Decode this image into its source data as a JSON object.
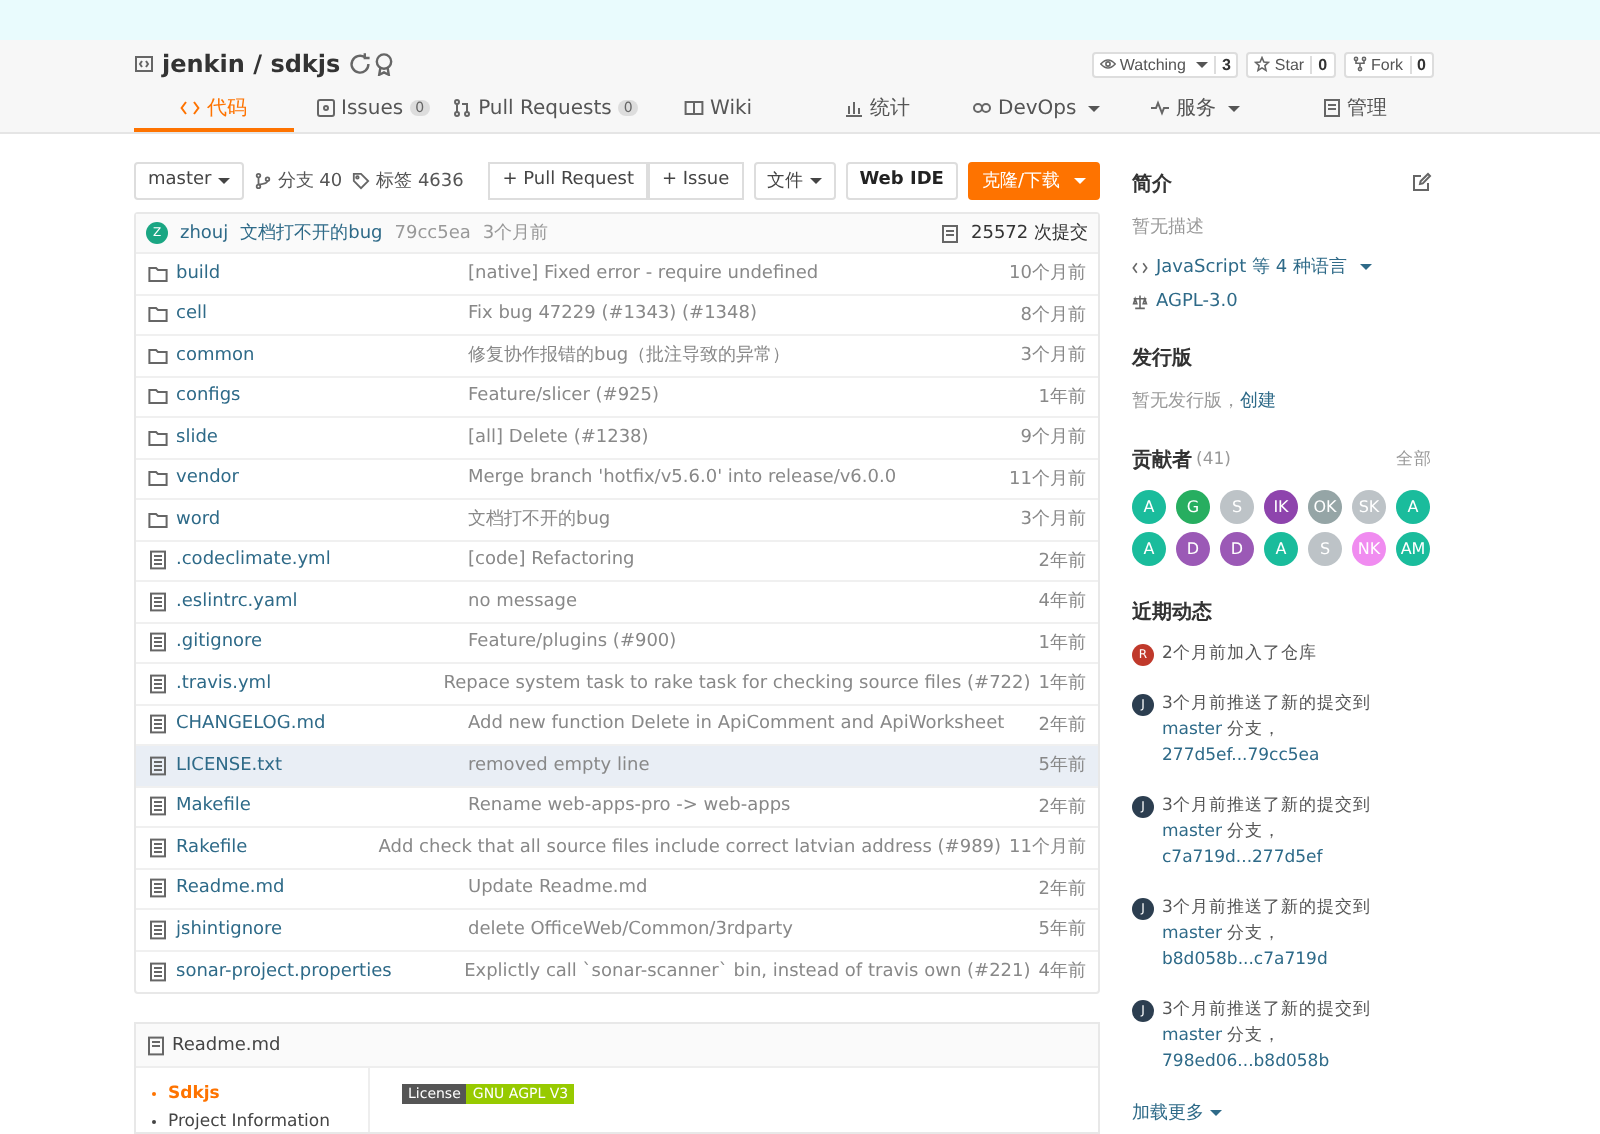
{
  "repo": {
    "owner": "jenkin",
    "sep": "/",
    "name": "sdkjs",
    "actions": [
      {
        "label": "Watching",
        "count": "3",
        "dropdown": true
      },
      {
        "label": "Star",
        "count": "0",
        "dropdown": false
      },
      {
        "label": "Fork",
        "count": "0",
        "dropdown": false
      }
    ]
  },
  "tabs": [
    {
      "label": "代码",
      "selected": true
    },
    {
      "label": "Issues",
      "count": "0",
      "selected": false
    },
    {
      "label": "Pull Requests",
      "count": "0",
      "selected": false
    },
    {
      "label": "Wiki",
      "selected": false
    },
    {
      "label": "统计",
      "selected": false
    },
    {
      "label": "DevOps",
      "dropdown": true,
      "selected": false
    },
    {
      "label": "服务",
      "dropdown": true,
      "selected": false
    },
    {
      "label": "管理",
      "selected": false
    }
  ],
  "toolbar": {
    "branch": "master",
    "branches": "分支 40",
    "tags": "标签 4636",
    "buttons": [
      {
        "label": "+ Pull Request",
        "kind": "plain"
      },
      {
        "label": "+ Issue",
        "kind": "plain"
      },
      {
        "label": "文件",
        "kind": "dropdown"
      },
      {
        "label": "Web IDE",
        "kind": "bold"
      },
      {
        "label": "克隆/下载",
        "kind": "primary"
      }
    ]
  },
  "latest_commit": {
    "avatar": "Z",
    "author": "zhouj",
    "message": "文档打不开的bug",
    "sha": "79cc5ea",
    "time": "3个月前",
    "commits": "25572 次提交"
  },
  "files": [
    {
      "kind": "folder",
      "name": "build",
      "message": "[native] Fixed error - require undefined",
      "time": "10个月前",
      "hovered": false
    },
    {
      "kind": "folder",
      "name": "cell",
      "message": "Fix bug 47229 (#1343) (#1348)",
      "time": "8个月前",
      "hovered": false
    },
    {
      "kind": "folder",
      "name": "common",
      "message": "修复协作报错的bug（批注导致的异常）",
      "time": "3个月前",
      "hovered": false
    },
    {
      "kind": "folder",
      "name": "configs",
      "message": "Feature/slicer (#925)",
      "time": "1年前",
      "hovered": false
    },
    {
      "kind": "folder",
      "name": "slide",
      "message": "[all] Delete (#1238)",
      "time": "9个月前",
      "hovered": false
    },
    {
      "kind": "folder",
      "name": "vendor",
      "message": "Merge branch 'hotfix/v5.6.0' into release/v6.0.0",
      "time": "11个月前",
      "hovered": false
    },
    {
      "kind": "folder",
      "name": "word",
      "message": "文档打不开的bug",
      "time": "3个月前",
      "hovered": false
    },
    {
      "kind": "file",
      "name": ".codeclimate.yml",
      "message": "[code] Refactoring",
      "time": "2年前",
      "hovered": false
    },
    {
      "kind": "file",
      "name": ".eslintrc.yaml",
      "message": "no message",
      "time": "4年前",
      "hovered": false
    },
    {
      "kind": "file",
      "name": ".gitignore",
      "message": "Feature/plugins (#900)",
      "time": "1年前",
      "hovered": false
    },
    {
      "kind": "file",
      "name": ".travis.yml",
      "message": "Repace system task to rake task for checking source files (#722)",
      "time": "1年前",
      "hovered": false
    },
    {
      "kind": "file",
      "name": "CHANGELOG.md",
      "message": "Add new function Delete in ApiComment and ApiWorksheet",
      "time": "2年前",
      "hovered": false
    },
    {
      "kind": "file",
      "name": "LICENSE.txt",
      "message": "removed empty line",
      "time": "5年前",
      "hovered": true
    },
    {
      "kind": "file",
      "name": "Makefile",
      "message": "Rename web-apps-pro -> web-apps",
      "time": "2年前",
      "hovered": false
    },
    {
      "kind": "file",
      "name": "Rakefile",
      "message": "Add check that all source files include correct latvian address (#989)",
      "time": "11个月前",
      "hovered": false
    },
    {
      "kind": "file",
      "name": "Readme.md",
      "message": "Update Readme.md",
      "time": "2年前",
      "hovered": false
    },
    {
      "kind": "file",
      "name": "jshintignore",
      "message": "delete OfficeWeb/Common/3rdparty",
      "time": "5年前",
      "hovered": false
    },
    {
      "kind": "file",
      "name": "sonar-project.properties",
      "message": "Explictly call `sonar-scanner` bin, instead of travis own (#221)",
      "time": "4年前",
      "hovered": false
    }
  ],
  "readme": {
    "title": "Readme.md",
    "toc": [
      {
        "label": "Sdkjs",
        "selected": true
      },
      {
        "label": "Project Information",
        "selected": false
      }
    ],
    "badge": {
      "label": "License",
      "value": "GNU AGPL V3"
    }
  },
  "sidebar": {
    "intro": {
      "title": "简介",
      "description": "暂无描述",
      "languages": "JavaScript 等 4 种语言",
      "license": "AGPL-3.0"
    },
    "releases": {
      "title": "发行版",
      "text": "暂无发行版，",
      "link": "创建"
    },
    "contributors": {
      "title": "贡献者",
      "count": "(41)",
      "all": "全部",
      "people": [
        {
          "initials": "A",
          "color": "#1abc9c"
        },
        {
          "initials": "G",
          "color": "#27ae60"
        },
        {
          "initials": "S",
          "color": "#bdc3c7"
        },
        {
          "initials": "IK",
          "color": "#8e44ad"
        },
        {
          "initials": "OK",
          "color": "#95a5a6"
        },
        {
          "initials": "SK",
          "color": "#bdc3c7"
        },
        {
          "initials": "A",
          "color": "#1abc9c"
        },
        {
          "initials": "A",
          "color": "#1abc9c"
        },
        {
          "initials": "D",
          "color": "#9b59b6"
        },
        {
          "initials": "D",
          "color": "#9b59b6"
        },
        {
          "initials": "A",
          "color": "#1abc9c"
        },
        {
          "initials": "S",
          "color": "#bdc3c7"
        },
        {
          "initials": "NK",
          "color": "#f08cf0"
        },
        {
          "initials": "AM",
          "color": "#1abc9c"
        }
      ]
    },
    "activity": {
      "title": "近期动态",
      "more": "加载更多",
      "items": [
        {
          "avatar": "R",
          "color": "#c0392b",
          "segments": [
            {
              "kind": "text",
              "text": "2个月前加入了仓库"
            }
          ]
        },
        {
          "avatar": "J",
          "color": "#2c3e50",
          "segments": [
            {
              "kind": "text",
              "text": "3个月前推送了新的提交到 "
            },
            {
              "kind": "link",
              "text": "master"
            },
            {
              "kind": "text",
              "text": " 分支，"
            },
            {
              "kind": "link",
              "text": "277d5ef...79cc5ea"
            }
          ]
        },
        {
          "avatar": "J",
          "color": "#2c3e50",
          "segments": [
            {
              "kind": "text",
              "text": "3个月前推送了新的提交到 "
            },
            {
              "kind": "link",
              "text": "master"
            },
            {
              "kind": "text",
              "text": " 分支，"
            },
            {
              "kind": "link",
              "text": "c7a719d...277d5ef"
            }
          ]
        },
        {
          "avatar": "J",
          "color": "#2c3e50",
          "segments": [
            {
              "kind": "text",
              "text": "3个月前推送了新的提交到 "
            },
            {
              "kind": "link",
              "text": "master"
            },
            {
              "kind": "text",
              "text": " 分支，"
            },
            {
              "kind": "link",
              "text": "b8d058b...c7a719d"
            }
          ]
        },
        {
          "avatar": "J",
          "color": "#2c3e50",
          "segments": [
            {
              "kind": "text",
              "text": "3个月前推送了新的提交到 "
            },
            {
              "kind": "link",
              "text": "master"
            },
            {
              "kind": "text",
              "text": " 分支，"
            },
            {
              "kind": "link",
              "text": "798ed06...b8d058b"
            }
          ]
        }
      ]
    }
  }
}
